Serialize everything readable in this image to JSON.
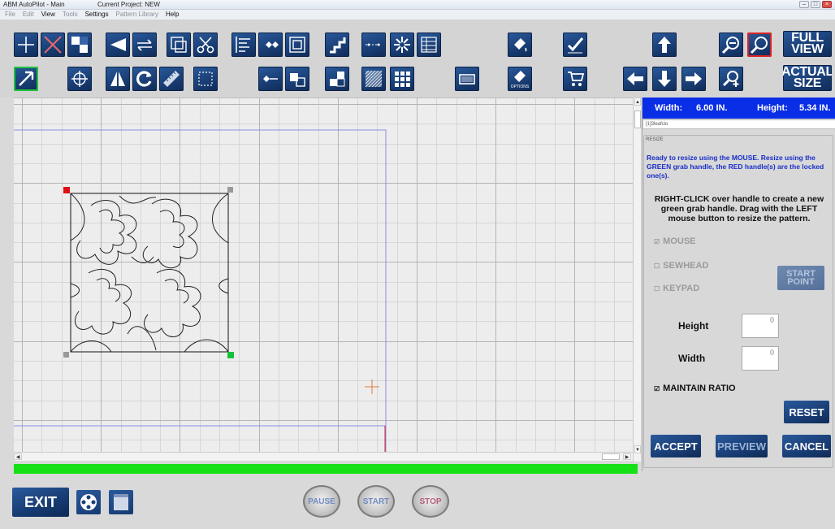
{
  "window": {
    "title": "ABM AutoPilot - Main",
    "project": "Current Project: NEW"
  },
  "menu": [
    {
      "label": "File",
      "active": false
    },
    {
      "label": "Edit",
      "active": false
    },
    {
      "label": "View",
      "active": true
    },
    {
      "label": "Tools",
      "active": false
    },
    {
      "label": "Settings",
      "active": true
    },
    {
      "label": "Pattern Library",
      "active": false
    },
    {
      "label": "Help",
      "active": true
    }
  ],
  "toolbar": {
    "full_view_line1": "FULL",
    "full_view_line2": "VIEW",
    "actual_size_line1": "ACTUAL",
    "actual_size_line2": "SIZE",
    "options_label": "OPTIONS",
    "icons": [
      "crosshair-add-icon",
      "delete-x-icon",
      "checker-icon",
      "mirror-arrow-icon",
      "flip-arrows-icon",
      "resize-box-icon",
      "scissors-icon",
      "align-icon",
      "diamond-nodes-icon",
      "square-nodes-icon",
      "stair-step-icon",
      "line-points-icon",
      "star-burst-icon",
      "grid-list-icon",
      "fill-bucket-icon",
      "check-icon",
      "arrow-up-icon",
      "zoom-out-icon",
      "zoom-in-icon",
      "pointer-arrow-icon",
      "target-icon",
      "mirror-triangle-icon",
      "rotate-icon",
      "ruler-icon",
      "dashed-box-icon",
      "nodes-left-icon",
      "nodes-box-icon",
      "blocks-icon",
      "texture-icon",
      "grid-icon",
      "panel-icon",
      "options-icon",
      "cart-icon",
      "arrow-left-icon",
      "arrow-down-icon",
      "arrow-right-icon",
      "zoom-plus-icon"
    ]
  },
  "dims": {
    "width_label": "Width:",
    "width_value": "6.00 IN.",
    "height_label": "Height:",
    "height_value": "5.34 IN."
  },
  "pattern_name": "[1]3leafclo",
  "resize": {
    "label": "RESIZE",
    "message_blue": "Ready to resize using the MOUSE. Resize using the GREEN grab handle, the RED handle(s) are the locked one(s).",
    "message_black_1": "RIGHT-CLICK over handle to create a new green grab handle. Drag with the",
    "message_black_bold": "LEFT",
    "message_black_2": "mouse button to resize the pattern.",
    "option_mouse": "MOUSE",
    "option_sewhead": "SEWHEAD",
    "option_keypad": "KEYPAD",
    "start_point_line1": "START",
    "start_point_line2": "POINT",
    "height_label": "Height",
    "height_value": "0",
    "width_label": "Width",
    "width_value": "0",
    "maintain_ratio": "MAINTAIN RATIO",
    "reset": "RESET",
    "accept": "ACCEPT",
    "preview": "PREVIEW",
    "cancel": "CANCEL",
    "check_mark": "☑",
    "uncheck_mark": "☐"
  },
  "bottom": {
    "exit": "EXIT",
    "pause": "PAUSE",
    "start": "START",
    "stop": "STOP"
  },
  "colors": {
    "accent_blue": "#0a2ee6",
    "progress_green": "#16e016",
    "handle_red": "#e01010",
    "handle_green": "#12c33a",
    "button_blue": "#1a3f77"
  }
}
